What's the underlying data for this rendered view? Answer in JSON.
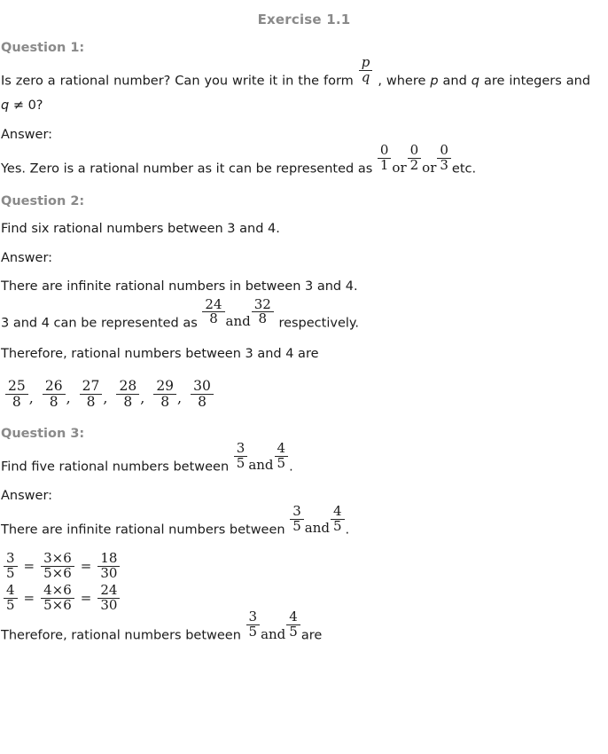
{
  "document": {
    "title": "Exercise 1.1",
    "heading_color": "#8a8a8a",
    "body_color": "#1a1a1a",
    "background": "#ffffff"
  },
  "q1": {
    "heading": "Question 1:",
    "prompt_part1": "Is zero a rational number? Can you write it in the form",
    "prompt_frac": {
      "num": "p",
      "den": "q"
    },
    "prompt_part2": ", where",
    "var_p": "p",
    "prompt_part3": "and",
    "var_q": "q",
    "prompt_part4": "are integers and",
    "var_q2": "q",
    "prompt_part5": "≠ 0?",
    "answer_label": "Answer:",
    "answer_part1": "Yes. Zero is a rational number as it can be represented as",
    "answer_fracs": [
      {
        "num": "0",
        "den": "1"
      },
      {
        "num": "0",
        "den": "2"
      },
      {
        "num": "0",
        "den": "3"
      }
    ],
    "answer_connector": "or",
    "answer_part2": "etc."
  },
  "q2": {
    "heading": "Question 2:",
    "prompt": "Find six rational numbers between 3 and 4.",
    "answer_label": "Answer:",
    "line1": "There are infinite rational numbers in between 3 and 4.",
    "line2_part1": "3 and 4 can be represented as",
    "line2_frac_a": {
      "num": "24",
      "den": "8"
    },
    "line2_connector": "and",
    "line2_frac_b": {
      "num": "32",
      "den": "8"
    },
    "line2_part2": "respectively.",
    "line3": "Therefore, rational numbers between 3 and 4 are",
    "result_fractions": [
      {
        "num": "25",
        "den": "8",
        "sep": ","
      },
      {
        "num": "26",
        "den": "8",
        "sep": ","
      },
      {
        "num": "27",
        "den": "8",
        "sep": ","
      },
      {
        "num": "28",
        "den": "8",
        "sep": ","
      },
      {
        "num": "29",
        "den": "8",
        "sep": ","
      },
      {
        "num": "30",
        "den": "8",
        "sep": ""
      }
    ]
  },
  "q3": {
    "heading": "Question 3:",
    "prompt_part1": "Find five rational numbers between",
    "prompt_frac_a": {
      "num": "3",
      "den": "5"
    },
    "prompt_connector": "and",
    "prompt_frac_b": {
      "num": "4",
      "den": "5"
    },
    "prompt_part2": ".",
    "answer_label": "Answer:",
    "line1_part1": "There are infinite rational numbers between",
    "line1_frac_a": {
      "num": "3",
      "den": "5"
    },
    "line1_connector": "and",
    "line1_frac_b": {
      "num": "4",
      "den": "5"
    },
    "line1_part2": ".",
    "equations": [
      {
        "lhs": {
          "num": "3",
          "den": "5"
        },
        "eq1": "=",
        "mid": {
          "num": "3×6",
          "den": "5×6"
        },
        "eq2": "=",
        "rhs": {
          "num": "18",
          "den": "30"
        }
      },
      {
        "lhs": {
          "num": "4",
          "den": "5"
        },
        "eq1": "=",
        "mid": {
          "num": "4×6",
          "den": "5×6"
        },
        "eq2": "=",
        "rhs": {
          "num": "24",
          "den": "30"
        }
      }
    ],
    "closing_part1": "Therefore, rational numbers between",
    "closing_frac_a": {
      "num": "3",
      "den": "5"
    },
    "closing_connector": "and",
    "closing_frac_b": {
      "num": "4",
      "den": "5"
    },
    "closing_part2": "are"
  }
}
